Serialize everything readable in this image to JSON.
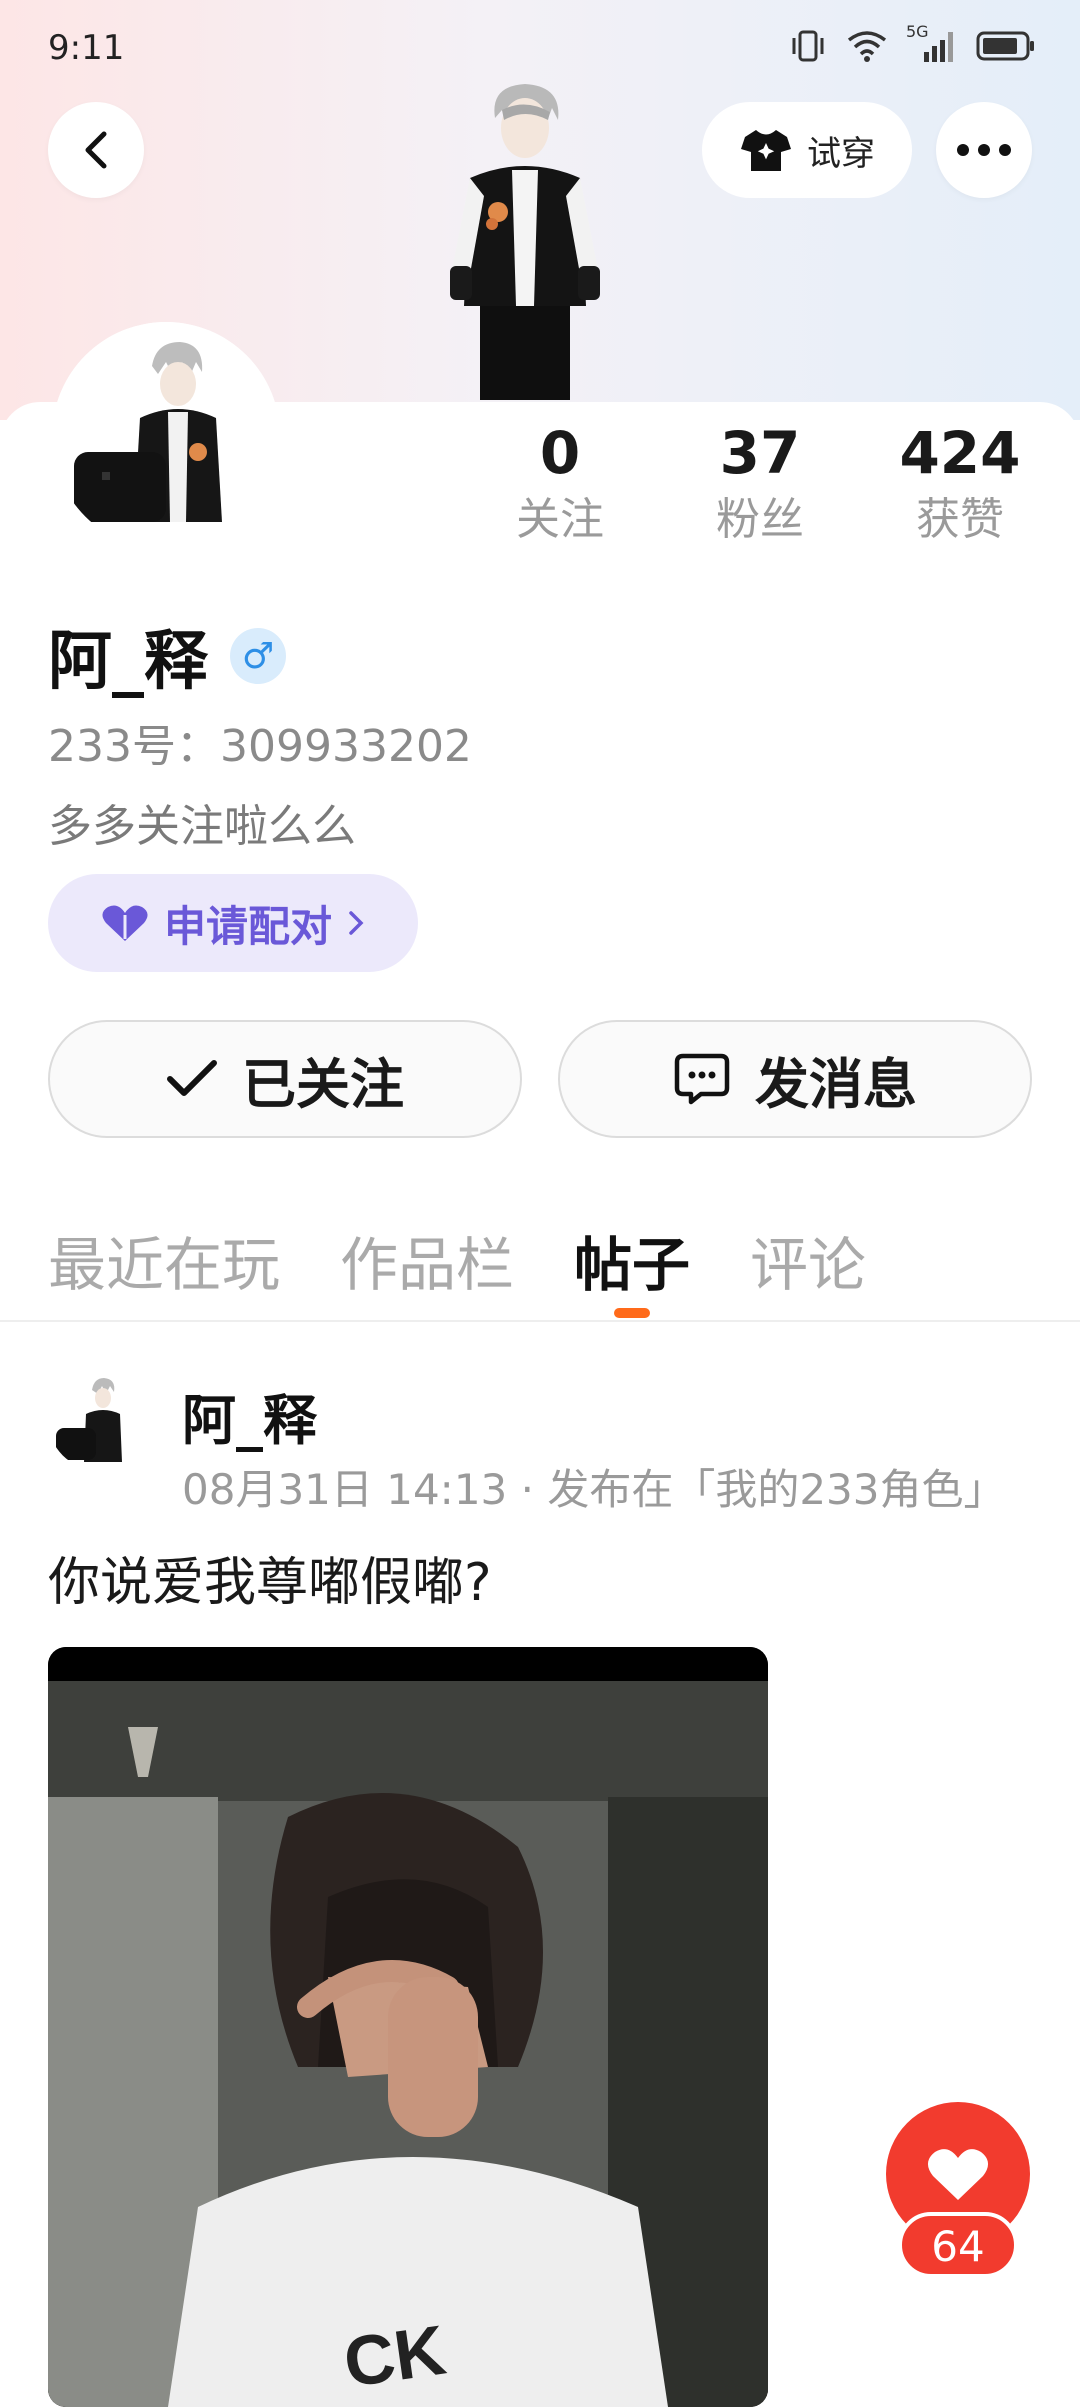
{
  "status_bar": {
    "time": "9:11",
    "network": "5G"
  },
  "header": {
    "tryon_label": "试穿"
  },
  "profile": {
    "name": "阿_释",
    "gender": "♂",
    "uid": "233号：309933202",
    "bio": "多多关注啦么么",
    "pair_label": "申请配对",
    "stats": [
      {
        "value": "0",
        "label": "关注"
      },
      {
        "value": "37",
        "label": "粉丝"
      },
      {
        "value": "424",
        "label": "获赞"
      }
    ]
  },
  "actions": {
    "follow_label": "已关注",
    "message_label": "发消息"
  },
  "tabs": [
    {
      "label": "最近在玩",
      "active": false
    },
    {
      "label": "作品栏",
      "active": false
    },
    {
      "label": "帖子",
      "active": true
    },
    {
      "label": "评论",
      "active": false
    }
  ],
  "post": {
    "author": "阿_释",
    "meta": "08月31日 14:13 · 发布在「我的233角色」",
    "text": "你说爱我尊嘟假嘟?"
  },
  "like": {
    "count": "64"
  },
  "colors": {
    "accent_orange": "#ff6a1a",
    "like_red": "#f23b2e",
    "pair_purple": "#6a58d8"
  }
}
